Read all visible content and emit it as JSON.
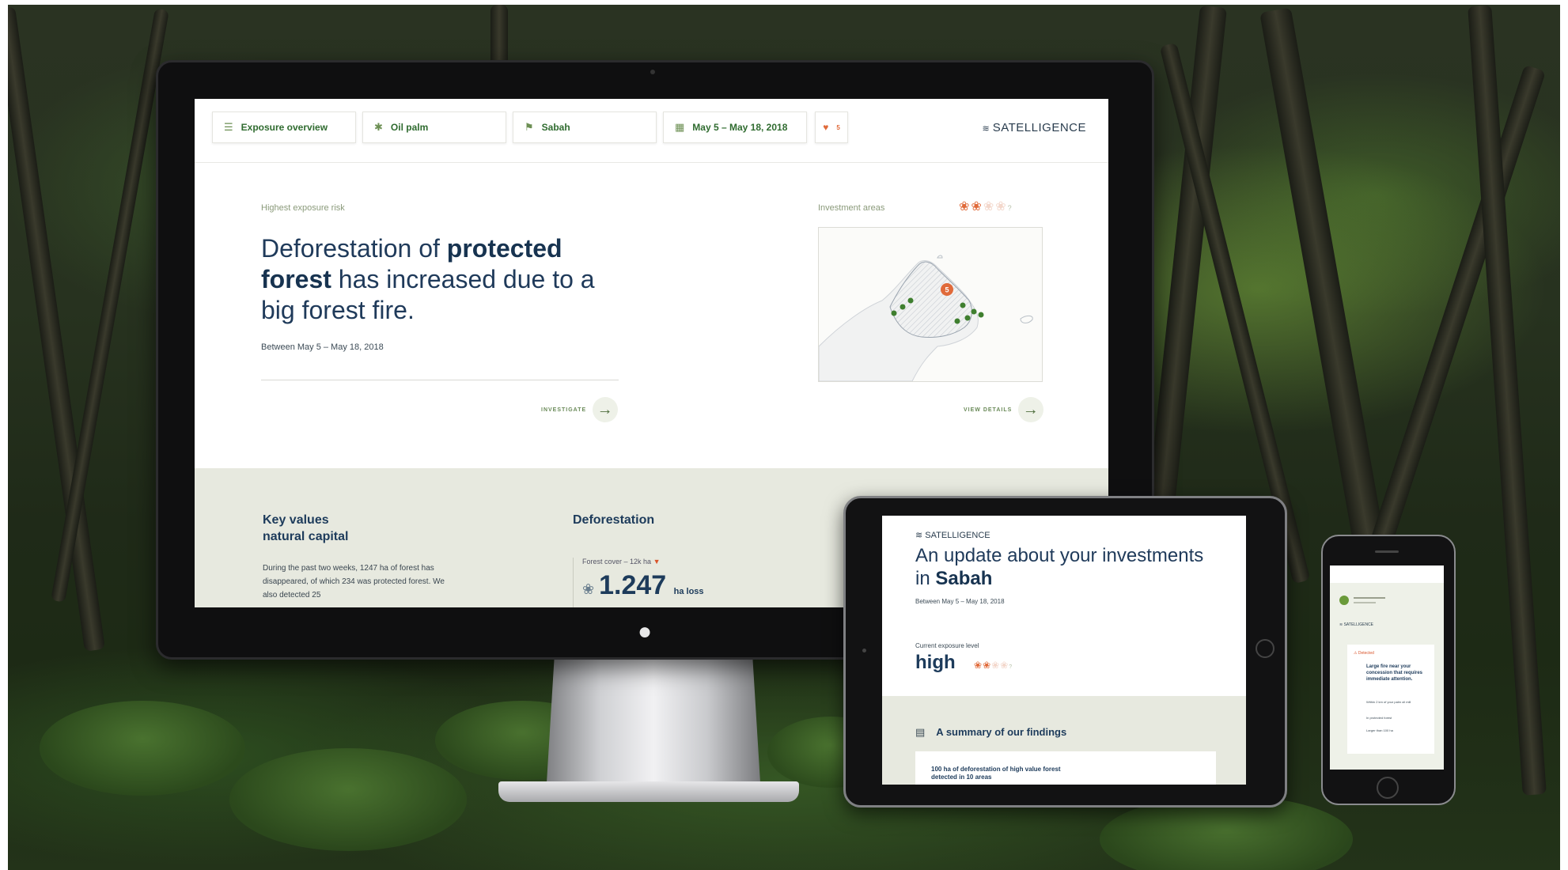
{
  "monitor": {
    "topbar": {
      "view_label": "Exposure overview",
      "commodity_label": "Oil palm",
      "region_label": "Sabah",
      "date_range_label": "May 5 – May 18, 2018",
      "alert_count": "5",
      "brand": "SATELLIGENCE"
    },
    "hero": {
      "kicker": "Highest exposure risk",
      "headline_part1": "Deforestation of ",
      "headline_bold1": "protected forest",
      "headline_part2": " has increased due to a big forest fire.",
      "subline": "Between May 5 – May 18, 2018",
      "cta_label": "INVESTIGATE"
    },
    "investment": {
      "kicker": "Investment areas",
      "map_cluster_count": "5",
      "cta_label": "VIEW DETAILS"
    },
    "panel": {
      "key_values_title_line1": "Key values",
      "key_values_title_line2": "natural capital",
      "key_values_text": "During the past two weeks, 1247 ha of forest has disappeared, of which 234 was protected forest. We also detected 25",
      "deforestation_title": "Deforestation",
      "forest_cover_caption": "Forest cover – 12k ha",
      "loss_value": "1.247",
      "loss_unit": "ha loss"
    }
  },
  "tablet": {
    "brand": "SATELLIGENCE",
    "title_part1": "An update about your investments in ",
    "title_bold": "Sabah",
    "date": "Between May 5 – May 18, 2018",
    "exposure_caption": "Current exposure level",
    "exposure_level": "high",
    "summary_title": "A summary of our findings",
    "finding_text": "100 ha of deforestation of high value forest detected in 10 areas"
  },
  "phone": {
    "brand": "SATELLIGENCE",
    "alert_label": "Detected",
    "alert_title": "Large fire near your concession that requires immediate attention.",
    "detail_1": "Within 2 km of your palm oil mill",
    "detail_2": "In protected forest",
    "detail_3": "Larger than 100 ha"
  },
  "icons": {
    "menu": "menu-icon",
    "commodity": "palm-icon",
    "region": "flag-icon",
    "calendar": "calendar-icon",
    "bell": "bell-icon",
    "leaf": "leaf-icon",
    "arrow": "arrow-right-icon"
  },
  "colors": {
    "accent_green": "#2f6b2f",
    "alert_orange": "#e06a3a",
    "navy_text": "#1d3b5b",
    "panel_beige": "#e7e9df"
  },
  "exposure_leaves": {
    "active": 2,
    "total": 4
  }
}
